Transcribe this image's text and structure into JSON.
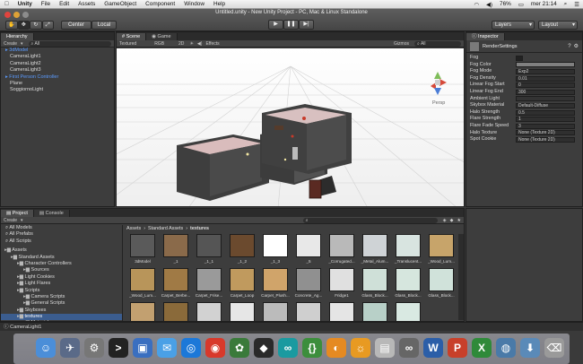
{
  "menubar": {
    "apple_icon": "apple-icon",
    "items": [
      "Unity",
      "File",
      "Edit",
      "Assets",
      "GameObject",
      "Component",
      "Window",
      "Help"
    ],
    "battery": "76%",
    "clock": "mer 21:14"
  },
  "window": {
    "title": "Untitled.unity - New Unity Project - PC, Mac & Linux Standalone"
  },
  "toolbar": {
    "pivot": "Center",
    "space": "Local",
    "layers": "Layers",
    "layout": "Layout"
  },
  "hierarchy": {
    "tab": "Hierarchy",
    "create": "Create",
    "search_label": "All",
    "items": [
      {
        "label": "3dModel",
        "style": "blue"
      },
      {
        "label": "CameraLight1",
        "style": "normal"
      },
      {
        "label": "CameraLight2",
        "style": "normal"
      },
      {
        "label": "CameraLight3",
        "style": "normal"
      },
      {
        "label": "First Person Controller",
        "style": "blue"
      },
      {
        "label": "Plane",
        "style": "normal"
      },
      {
        "label": "SoggiornoLight",
        "style": "normal"
      }
    ]
  },
  "scene": {
    "tabs": [
      "Scene",
      "Game"
    ],
    "shading": "Textured",
    "render": "RGB",
    "mode_2d": "2D",
    "effects": "Effects",
    "gizmos": "Gizmos",
    "search": "All",
    "persp": "Persp"
  },
  "inspector": {
    "tab": "Inspector",
    "title": "RenderSettings",
    "rows": [
      {
        "key": "Fog",
        "value": ""
      },
      {
        "key": "Fog Color",
        "value": ""
      },
      {
        "key": "Fog Mode",
        "value": "Exp2"
      },
      {
        "key": "Fog Density",
        "value": "0.01"
      },
      {
        "key": "Linear Fog Start",
        "value": "0"
      },
      {
        "key": "Linear Fog End",
        "value": "300"
      },
      {
        "key": "Ambient Light",
        "value": ""
      },
      {
        "key": "Skybox Material",
        "value": "Default-Diffuse"
      },
      {
        "key": "Halo Strength",
        "value": "0.5"
      },
      {
        "key": "Flare Strength",
        "value": "1"
      },
      {
        "key": "Flare Fade Speed",
        "value": "3"
      },
      {
        "key": "Halo Texture",
        "value": "None (Texture 2D)"
      },
      {
        "key": "Spot Cookie",
        "value": "None (Texture 2D)"
      }
    ]
  },
  "project": {
    "tabs": [
      "Project",
      "Console"
    ],
    "create": "Create",
    "breadcrumb": [
      "Assets",
      "Standard Assets",
      "textures"
    ],
    "favorites": [
      "All Models",
      "All Prefabs",
      "All Scripts"
    ],
    "tree": [
      {
        "label": "Assets",
        "indent": 0
      },
      {
        "label": "Standard Assets",
        "indent": 1
      },
      {
        "label": "Character Controllers",
        "indent": 2
      },
      {
        "label": "Sources",
        "indent": 3
      },
      {
        "label": "Light Cookies",
        "indent": 2
      },
      {
        "label": "Light Flares",
        "indent": 2
      },
      {
        "label": "Scripts",
        "indent": 2
      },
      {
        "label": "Camera Scripts",
        "indent": 3
      },
      {
        "label": "General Scripts",
        "indent": 3
      },
      {
        "label": "Skyboxes",
        "indent": 2
      },
      {
        "label": "textures",
        "indent": 2,
        "selected": true
      },
      {
        "label": "Materials",
        "indent": 3
      }
    ],
    "assets_row1": [
      {
        "label": "3dModel",
        "color": "#5a5a5a"
      },
      {
        "label": "_1",
        "color": "#8a6a4a"
      },
      {
        "label": "_1_1",
        "color": "#555"
      },
      {
        "label": "_1_2",
        "color": "#6b4a2e"
      },
      {
        "label": "_1_3",
        "color": "#ffffff"
      },
      {
        "label": "_5",
        "color": "#e8e8e8"
      },
      {
        "label": "_Corrugated...",
        "color": "#b9b9b9"
      },
      {
        "label": "_Metal_Alum...",
        "color": "#cfd3d6"
      },
      {
        "label": "_Translucent...",
        "color": "#d8e4e0"
      },
      {
        "label": "_Wood_Lum...",
        "color": "#c7a46a"
      }
    ],
    "assets_row2": [
      {
        "label": "_Wood_Lum...",
        "color": "#b8955a"
      },
      {
        "label": "Carpet_Berbe...",
        "color": "#a07a45"
      },
      {
        "label": "Carpet_Frise...",
        "color": "#9a9a9a"
      },
      {
        "label": "Carpet_Loop",
        "color": "#c09a5e"
      },
      {
        "label": "Carpet_Plush...",
        "color": "#d0a46a"
      },
      {
        "label": "Concrete_Ag...",
        "color": "#909090"
      },
      {
        "label": "Fridge1",
        "color": "#e0e0e0"
      },
      {
        "label": "Glass_Block...",
        "color": "#cfe0d8"
      },
      {
        "label": "Glass_Block...",
        "color": "#d6e6de"
      },
      {
        "label": "Glass_Block...",
        "color": "#d0e2da"
      }
    ],
    "assets_row3": [
      "#c2a070",
      "#8a6a3a",
      "#d2d2d2",
      "#e6e6e6",
      "#bbbbbb",
      "#cfcfcf",
      "#e5e5e5",
      "#b8d0c8",
      "#d9e9e2"
    ]
  },
  "statusbar": {
    "text": "CameraLight1"
  },
  "dock": {
    "icons": [
      {
        "name": "finder-icon",
        "color": "#4b8ed8",
        "glyph": "☺"
      },
      {
        "name": "launchpad-icon",
        "color": "#5a6a88",
        "glyph": "✈"
      },
      {
        "name": "system-preferences-icon",
        "color": "#777",
        "glyph": "⚙"
      },
      {
        "name": "terminal-icon",
        "color": "#222",
        "glyph": ">"
      },
      {
        "name": "ios-simulator-icon",
        "color": "#3a6fc0",
        "glyph": "▣"
      },
      {
        "name": "messages-icon",
        "color": "#4aa0e6",
        "glyph": "✉"
      },
      {
        "name": "safari-icon",
        "color": "#1c78d8",
        "glyph": "◎"
      },
      {
        "name": "chrome-icon",
        "color": "#d8392b",
        "glyph": "◉"
      },
      {
        "name": "app-store-icon",
        "color": "#3a7a3a",
        "glyph": "✿"
      },
      {
        "name": "unity-icon",
        "color": "#2a2a2a",
        "glyph": "◆"
      },
      {
        "name": "arduino-icon",
        "color": "#1a9aa0",
        "glyph": "∞"
      },
      {
        "name": "brackets-icon",
        "color": "#3c8e3c",
        "glyph": "{}"
      },
      {
        "name": "blender-icon",
        "color": "#e58a22",
        "glyph": "◐"
      },
      {
        "name": "settings-gear-icon",
        "color": "#e89a22",
        "glyph": "☼"
      },
      {
        "name": "preview-icon",
        "color": "#b8b8b8",
        "glyph": "▤"
      },
      {
        "name": "glasses-icon",
        "color": "#666",
        "glyph": "∞"
      },
      {
        "name": "word-icon",
        "color": "#2b5ea8",
        "glyph": "W"
      },
      {
        "name": "powerpoint-icon",
        "color": "#c8402a",
        "glyph": "P"
      },
      {
        "name": "excel-icon",
        "color": "#2f8a3a",
        "glyph": "X"
      },
      {
        "name": "skype-icon",
        "color": "#4a7aa8",
        "glyph": "◍"
      },
      {
        "name": "downloads-icon",
        "color": "#5a8ab8",
        "glyph": "⬇"
      },
      {
        "name": "trash-icon",
        "color": "#9a9a9a",
        "glyph": "⌫"
      }
    ]
  },
  "colors": {
    "accent": "#3b5d8f",
    "link": "#5b9bff",
    "scene_sky": "#ffffff",
    "wall": "#3c3c3c",
    "floor": "#d7bcbc"
  }
}
